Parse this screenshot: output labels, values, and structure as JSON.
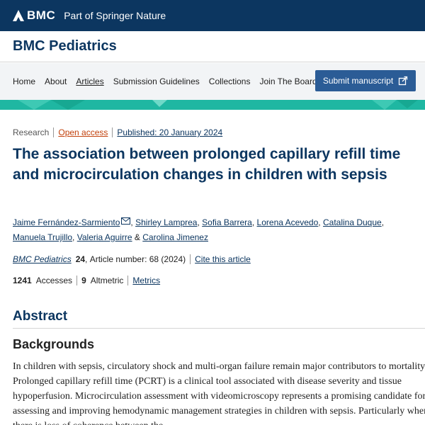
{
  "header": {
    "brand": "BMC",
    "tagline": "Part of Springer Nature"
  },
  "journal": {
    "title": "BMC Pediatrics"
  },
  "nav": {
    "items": [
      "Home",
      "About",
      "Articles",
      "Submission Guidelines",
      "Collections",
      "Join The Board"
    ],
    "active": "Articles",
    "submit_label": "Submit manuscript"
  },
  "article": {
    "type": "Research",
    "access": "Open access",
    "published": "Published: 20 January 2024",
    "title": "The association between prolonged capillary refill time and microcirculation changes in children with sepsis",
    "authors": [
      "Jaime Fernández-Sarmiento",
      "Shirley Lamprea",
      "Sofia Barrera",
      "Lorena Acevedo",
      "Catalina Duque",
      "Manuela Trujillo",
      "Valeria Aguirre",
      "Carolina Jimenez"
    ],
    "author_sep": ",",
    "author_last_join": "&",
    "journal_name": "BMC Pediatrics",
    "volume": "24",
    "article_number": "Article number: 68 (2024)",
    "cite_label": "Cite this article",
    "accesses_count": "1241",
    "accesses_label": "Accesses",
    "altmetric_count": "9",
    "altmetric_label": "Altmetric",
    "metrics_label": "Metrics"
  },
  "abstract": {
    "heading": "Abstract",
    "section_heading": "Backgrounds",
    "text": "In children with sepsis, circulatory shock and multi-organ failure remain major contributors to mortality. Prolonged capillary refill time (PCRT) is a clinical tool associated with disease severity and tissue hypoperfusion. Microcirculation assessment with videomicroscopy represents a promising candidate for assessing and improving hemodynamic management strategies in children with sepsis. Particularly when there is loss of coherence between the"
  },
  "colors": {
    "navy": "#0c3660",
    "teal": "#1fb7a2",
    "submit": "#2b5c96",
    "open_access": "#c2410c"
  },
  "icons": {
    "logo": "bmc-logo-icon",
    "submit": "external-link-icon",
    "mail": "mail-icon"
  }
}
